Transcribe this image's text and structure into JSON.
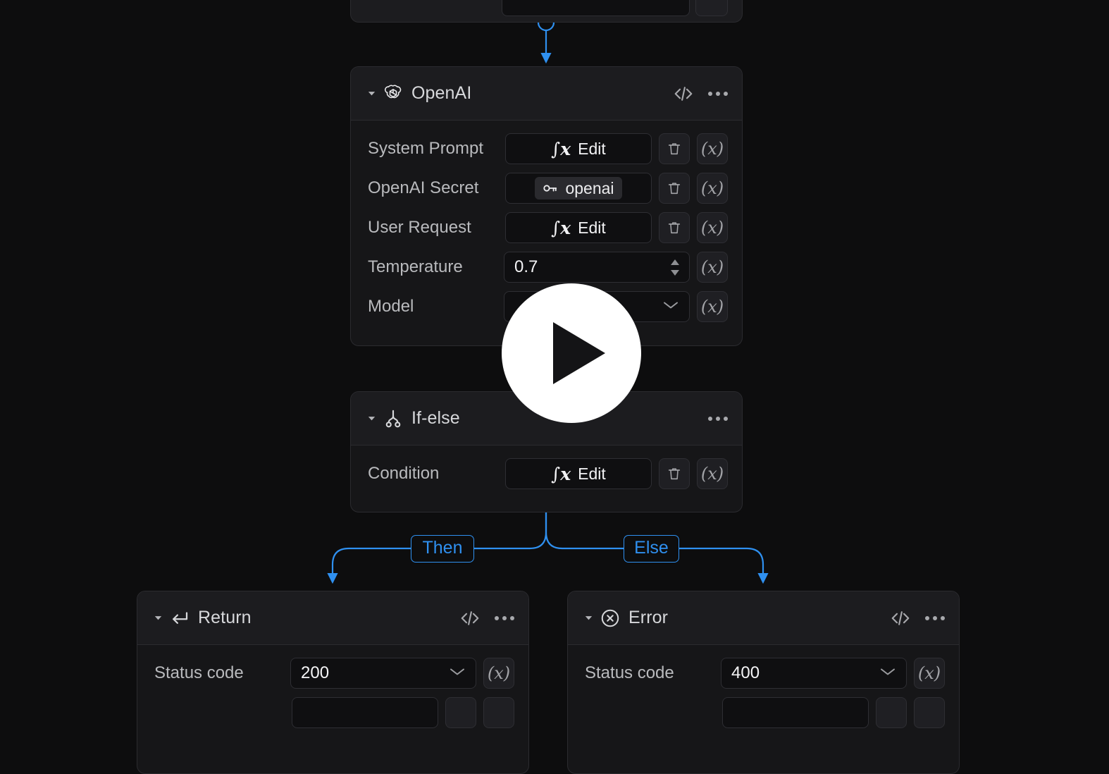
{
  "theme": {
    "canvas_bg": "#0d0d0e",
    "node_bg": "#161618",
    "node_header_bg": "#1c1c1f",
    "node_border": "#2b2b2f",
    "field_bg": "#0f0f11",
    "accent_edge": "#2f90f0",
    "text_primary": "#f2f2f4",
    "text_secondary": "#b9babd"
  },
  "nodes": {
    "top_partial": {
      "name": "partial-node-above"
    },
    "openai": {
      "title": "OpenAI",
      "icon": "openai-logo-icon",
      "caret": "caret-down-icon",
      "header_actions": {
        "code": "code-brackets-icon",
        "more": "more-horizontal-icon"
      },
      "fields": [
        {
          "label": "System Prompt",
          "kind": "fx",
          "value": "Edit",
          "glyph": "fx",
          "has_delete": true,
          "has_var": true
        },
        {
          "label": "OpenAI Secret",
          "kind": "chip",
          "value": "openai",
          "glyph": "key-icon",
          "has_delete": true,
          "has_var": true
        },
        {
          "label": "User Request",
          "kind": "fx",
          "value": "Edit",
          "glyph": "fx",
          "has_delete": true,
          "has_var": true
        },
        {
          "label": "Temperature",
          "kind": "number",
          "value": "0.7",
          "has_delete": false,
          "has_var": true
        },
        {
          "label": "Model",
          "kind": "select",
          "value": "",
          "has_delete": false,
          "has_var": true
        }
      ]
    },
    "ifelse": {
      "title": "If-else",
      "icon": "branch-fork-icon",
      "caret": "caret-down-icon",
      "header_actions": {
        "more": "more-horizontal-icon"
      },
      "fields": [
        {
          "label": "Condition",
          "kind": "fx",
          "value": "Edit",
          "glyph": "fx",
          "has_delete": true,
          "has_var": true
        }
      ]
    },
    "return": {
      "title": "Return",
      "icon": "return-arrow-icon",
      "caret": "caret-down-icon",
      "header_actions": {
        "code": "code-brackets-icon",
        "more": "more-horizontal-icon"
      },
      "fields": [
        {
          "label": "Status code",
          "kind": "select",
          "value": "200",
          "has_delete": false,
          "has_var": true
        }
      ]
    },
    "error": {
      "title": "Error",
      "icon": "circle-x-icon",
      "caret": "caret-down-icon",
      "header_actions": {
        "code": "code-brackets-icon",
        "more": "more-horizontal-icon"
      },
      "fields": [
        {
          "label": "Status code",
          "kind": "select",
          "value": "400",
          "has_delete": false,
          "has_var": true
        }
      ]
    }
  },
  "edges": {
    "then_label": "Then",
    "else_label": "Else"
  },
  "overlay": {
    "play_button": "play-icon"
  }
}
